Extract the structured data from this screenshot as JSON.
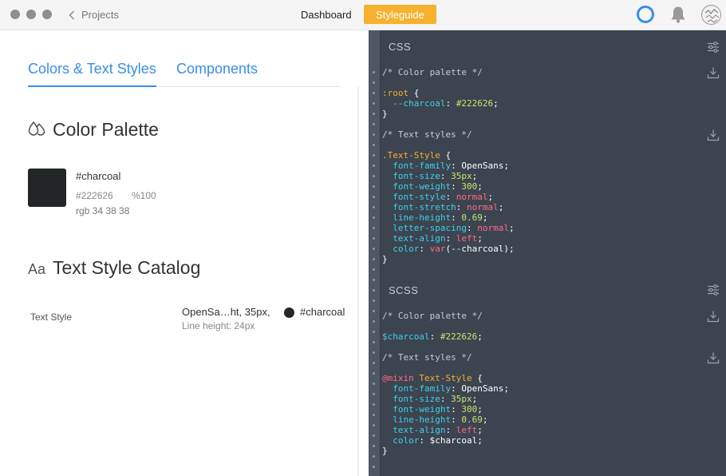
{
  "titlebar": {
    "back_label": "Projects",
    "nav_dashboard": "Dashboard",
    "nav_styleguide": "Styleguide",
    "icons": [
      "status-ring-icon",
      "bell-icon",
      "avatar"
    ],
    "colors": {
      "accent": "#f6b12e",
      "ring": "#3a8ee8"
    }
  },
  "tabs": {
    "colors_text": "Colors & Text Styles",
    "components": "Components"
  },
  "palette": {
    "title": "Color Palette",
    "color": {
      "name": "#charcoal",
      "hex": "#222626",
      "alpha": "%100",
      "rgb": "rgb 34 38 38",
      "swatch_color": "#222626"
    }
  },
  "catalog": {
    "icon_text": "Aa",
    "title": "Text Style Catalog",
    "styles": [
      {
        "name": "Text Style",
        "font": "OpenSa…ht, 35px,",
        "line_height": "Line height: 24px",
        "color_name": "#charcoal"
      }
    ]
  },
  "code": {
    "css_header": "CSS",
    "scss_header": "SCSS",
    "css": {
      "comment_palette": "/* Color palette */",
      "root_sel": ":root",
      "brace_open": " {",
      "var_name": "--charcoal",
      "var_value": "#222626",
      "brace_close": "}",
      "comment_text": "/* Text styles */",
      "class_sel": ".Text-Style",
      "props": [
        {
          "name": "font-family",
          "value": "OpenSans",
          "kind": "plain"
        },
        {
          "name": "font-size",
          "value": "35px",
          "kind": "num"
        },
        {
          "name": "font-weight",
          "value": "300",
          "kind": "num"
        },
        {
          "name": "font-style",
          "value": "normal",
          "kind": "kw"
        },
        {
          "name": "font-stretch",
          "value": "normal",
          "kind": "kw"
        },
        {
          "name": "line-height",
          "value": "0.69",
          "kind": "num"
        },
        {
          "name": "letter-spacing",
          "value": "normal",
          "kind": "kw"
        },
        {
          "name": "text-align",
          "value": "left",
          "kind": "kw"
        }
      ],
      "color_prop": "color",
      "color_var_fn": "var",
      "color_var_arg": "(--charcoal);"
    },
    "scss": {
      "comment_palette": "/* Color palette */",
      "var_name": "$charcoal",
      "var_value": "#222626",
      "comment_text": "/* Text styles */",
      "mixin_kw": "@mixin",
      "mixin_name": "Text-Style",
      "props": [
        {
          "name": "font-family",
          "value": "OpenSans",
          "kind": "plain"
        },
        {
          "name": "font-size",
          "value": "35px",
          "kind": "num"
        },
        {
          "name": "font-weight",
          "value": "300",
          "kind": "num"
        },
        {
          "name": "line-height",
          "value": "0.69",
          "kind": "num"
        },
        {
          "name": "text-align",
          "value": "left",
          "kind": "kw"
        }
      ],
      "color_prop": "color",
      "color_value": "$charcoal;"
    }
  }
}
